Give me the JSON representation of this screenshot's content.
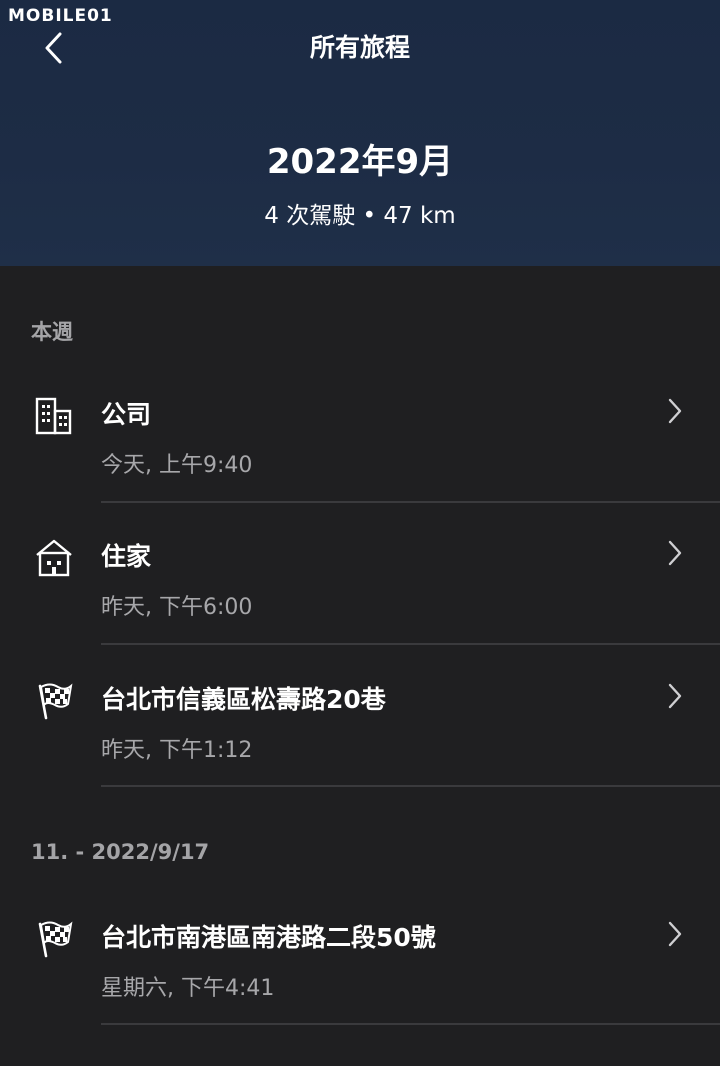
{
  "watermark": "MOBILE01",
  "nav": {
    "title": "所有旅程"
  },
  "summary": {
    "month": "2022年9月",
    "stats": "4 次駕駛 • 47 km"
  },
  "sections": [
    {
      "label": "本週",
      "trips": [
        {
          "icon": "office-building-icon",
          "title": "公司",
          "time": "今天, 上午9:40"
        },
        {
          "icon": "home-icon",
          "title": "住家",
          "time": "昨天, 下午6:00"
        },
        {
          "icon": "checkered-flag-icon",
          "title": "台北市信義區松壽路20巷",
          "time": "昨天, 下午1:12"
        }
      ]
    },
    {
      "label": "11. - 2022/9/17",
      "trips": [
        {
          "icon": "checkered-flag-icon",
          "title": "台北市南港區南港路二段50號",
          "time": "星期六, 下午4:41"
        }
      ]
    }
  ],
  "colors": {
    "header_bg": "#1d2c45",
    "page_bg": "#1f1f21",
    "secondary_text": "#a7a7aa",
    "divider": "#3a3a3d"
  }
}
